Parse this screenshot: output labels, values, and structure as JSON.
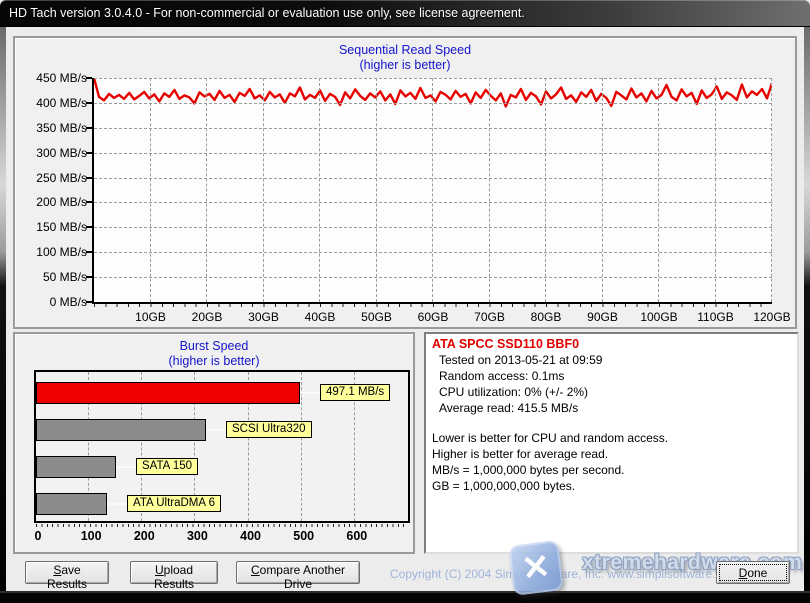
{
  "window": {
    "title": "HD Tach version 3.0.4.0  - For non-commercial or evaluation use only, see license agreement."
  },
  "chart_data": [
    {
      "type": "line",
      "title": "Sequential Read Speed",
      "subtitle": "(higher is better)",
      "legend_position": "none",
      "grid": "dashed",
      "line_color": "#e60000",
      "ylim": [
        0,
        450
      ],
      "y_unit": "MB/s",
      "y_ticks": [
        "450 MB/s",
        "400 MB/s",
        "350 MB/s",
        "300 MB/s",
        "250 MB/s",
        "200 MB/s",
        "150 MB/s",
        "100 MB/s",
        "50 MB/s",
        "0 MB/s"
      ],
      "x_ticks": [
        "10GB",
        "20GB",
        "30GB",
        "40GB",
        "50GB",
        "60GB",
        "70GB",
        "80GB",
        "90GB",
        "100GB",
        "110GB",
        "120GB"
      ],
      "xlim_gb": [
        0,
        120
      ],
      "series_name": "Sequential read speed (MB/s)",
      "series_mbps": [
        450,
        412,
        405,
        418,
        410,
        416,
        408,
        420,
        407,
        414,
        422,
        409,
        417,
        403,
        419,
        412,
        426,
        408,
        415,
        411,
        399,
        421,
        413,
        418,
        406,
        424,
        410,
        416,
        402,
        420,
        414,
        428,
        409,
        415,
        405,
        422,
        411,
        417,
        400,
        419,
        413,
        431,
        407,
        416,
        410,
        425,
        404,
        418,
        412,
        396,
        421,
        409,
        427,
        414,
        406,
        419,
        411,
        423,
        405,
        417,
        398,
        425,
        413,
        420,
        408,
        430,
        410,
        415,
        403,
        422,
        416,
        407,
        424,
        412,
        418,
        399,
        421,
        410,
        426,
        414,
        405,
        419,
        393,
        416,
        411,
        428,
        406,
        420,
        413,
        397,
        423,
        409,
        417,
        431,
        408,
        415,
        402,
        421,
        412,
        426,
        404,
        418,
        410,
        394,
        422,
        415,
        407,
        429,
        411,
        419,
        403,
        424,
        409,
        416,
        436,
        412,
        405,
        427,
        413,
        420,
        398,
        425,
        410,
        417,
        433,
        408,
        421,
        415,
        406,
        437,
        411,
        423,
        416,
        428,
        409,
        440
      ]
    },
    {
      "type": "bar",
      "title": "Burst Speed",
      "subtitle": "(higher is better)",
      "orientation": "horizontal",
      "xlim": [
        0,
        700
      ],
      "x_ticks": [
        "0",
        "100",
        "200",
        "300",
        "400",
        "500",
        "600"
      ],
      "label_bg": "#ffff9c",
      "bars": [
        {
          "label": "497.1 MB/s",
          "value": 497.1,
          "color": "#ee0000"
        },
        {
          "label": "SCSI Ultra320",
          "value": 320,
          "color": "#8c8c8c"
        },
        {
          "label": "SATA 150",
          "value": 150,
          "color": "#8c8c8c"
        },
        {
          "label": "ATA UltraDMA 6",
          "value": 133,
          "color": "#8c8c8c"
        }
      ]
    }
  ],
  "info_panel": {
    "drive": "ATA SPCC SSD110 BBF0",
    "lines": [
      "Tested on 2013-05-21 at 09:59",
      "Random access: 0.1ms",
      "CPU utilization: 0% (+/- 2%)",
      "Average read: 415.5 MB/s"
    ],
    "notes": [
      "Lower is better for CPU and random access.",
      "Higher is better for average read.",
      "MB/s = 1,000,000 bytes per second.",
      "GB = 1,000,000,000 bytes."
    ]
  },
  "footer": {
    "buttons": [
      {
        "label": "Save Results",
        "underline_index": 0
      },
      {
        "label": "Upload Results",
        "underline_index": 0
      },
      {
        "label": "Compare Another Drive",
        "underline_index": 0
      },
      {
        "label": "Done",
        "underline_index": 0
      }
    ],
    "copyright": "Copyright (C) 2004 Simpli Software, Inc. www.simplisoftware.com",
    "watermark_text": "xtremehardware.com",
    "watermark_x_glyph": "✕"
  }
}
